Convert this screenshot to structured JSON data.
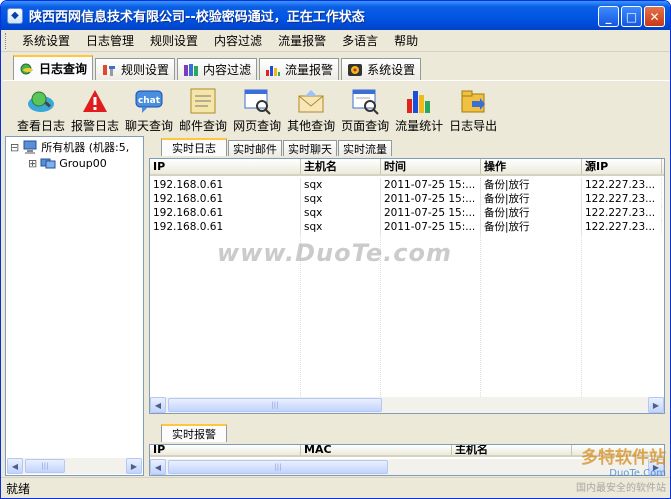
{
  "window": {
    "title": "陕西西网信息技术有限公司--校验密码通过，正在工作状态",
    "buttons": {
      "minimize": "_",
      "maximize": "□",
      "close": "✕"
    }
  },
  "menu": [
    "系统设置",
    "日志管理",
    "规则设置",
    "内容过滤",
    "流量报警",
    "多语言",
    "帮助"
  ],
  "main_tabs": [
    {
      "label": "日志查询",
      "active": true,
      "icon": "globe-search-icon"
    },
    {
      "label": "规则设置",
      "active": false,
      "icon": "tools-icon"
    },
    {
      "label": "内容过滤",
      "active": false,
      "icon": "books-icon"
    },
    {
      "label": "流量报警",
      "active": false,
      "icon": "chart-icon"
    },
    {
      "label": "系统设置",
      "active": false,
      "icon": "settings-icon"
    }
  ],
  "toolbar": [
    {
      "label": "查看日志",
      "icon": "view-log-icon"
    },
    {
      "label": "报警日志",
      "icon": "alert-icon"
    },
    {
      "label": "聊天查询",
      "icon": "chat-icon"
    },
    {
      "label": "邮件查询",
      "icon": "mail-icon"
    },
    {
      "label": "网页查询",
      "icon": "webpage-icon"
    },
    {
      "label": "其他查询",
      "icon": "envelope-icon"
    },
    {
      "label": "页面查询",
      "icon": "page-search-icon"
    },
    {
      "label": "流量统计",
      "icon": "bar-chart-icon"
    },
    {
      "label": "日志导出",
      "icon": "export-icon"
    }
  ],
  "tree": {
    "root": "所有机器 (机器:5,",
    "root_toggle": "⊟",
    "child": "Group00",
    "child_toggle": "⊞"
  },
  "log_tabs": [
    "实时日志",
    "实时邮件",
    "实时聊天",
    "实时流量"
  ],
  "log_table": {
    "columns": [
      "IP",
      "主机名",
      "时间",
      "操作",
      "源IP"
    ],
    "rows": [
      [
        "192.168.0.61",
        "sqx",
        "2011-07-25 15:...",
        "备份|放行",
        "122.227.23..."
      ],
      [
        "192.168.0.61",
        "sqx",
        "2011-07-25 15:...",
        "备份|放行",
        "122.227.23..."
      ],
      [
        "192.168.0.61",
        "sqx",
        "2011-07-25 15:...",
        "备份|放行",
        "122.227.23..."
      ],
      [
        "192.168.0.61",
        "sqx",
        "2011-07-25 15:...",
        "备份|放行",
        "122.227.23..."
      ]
    ]
  },
  "alert_tab": "实时报警",
  "alert_table": {
    "columns": [
      "IP",
      "MAC",
      "主机名"
    ]
  },
  "watermark": "www.DuoTe.com",
  "status": "就绪",
  "brand": {
    "name": "多特软件站",
    "url": "DuoTe.Com",
    "slogan": "国内最安全的软件站"
  },
  "colors": {
    "titlebar": "#0054e3",
    "tab_highlight": "#ffc73c",
    "alert_red": "#e01c1c"
  }
}
